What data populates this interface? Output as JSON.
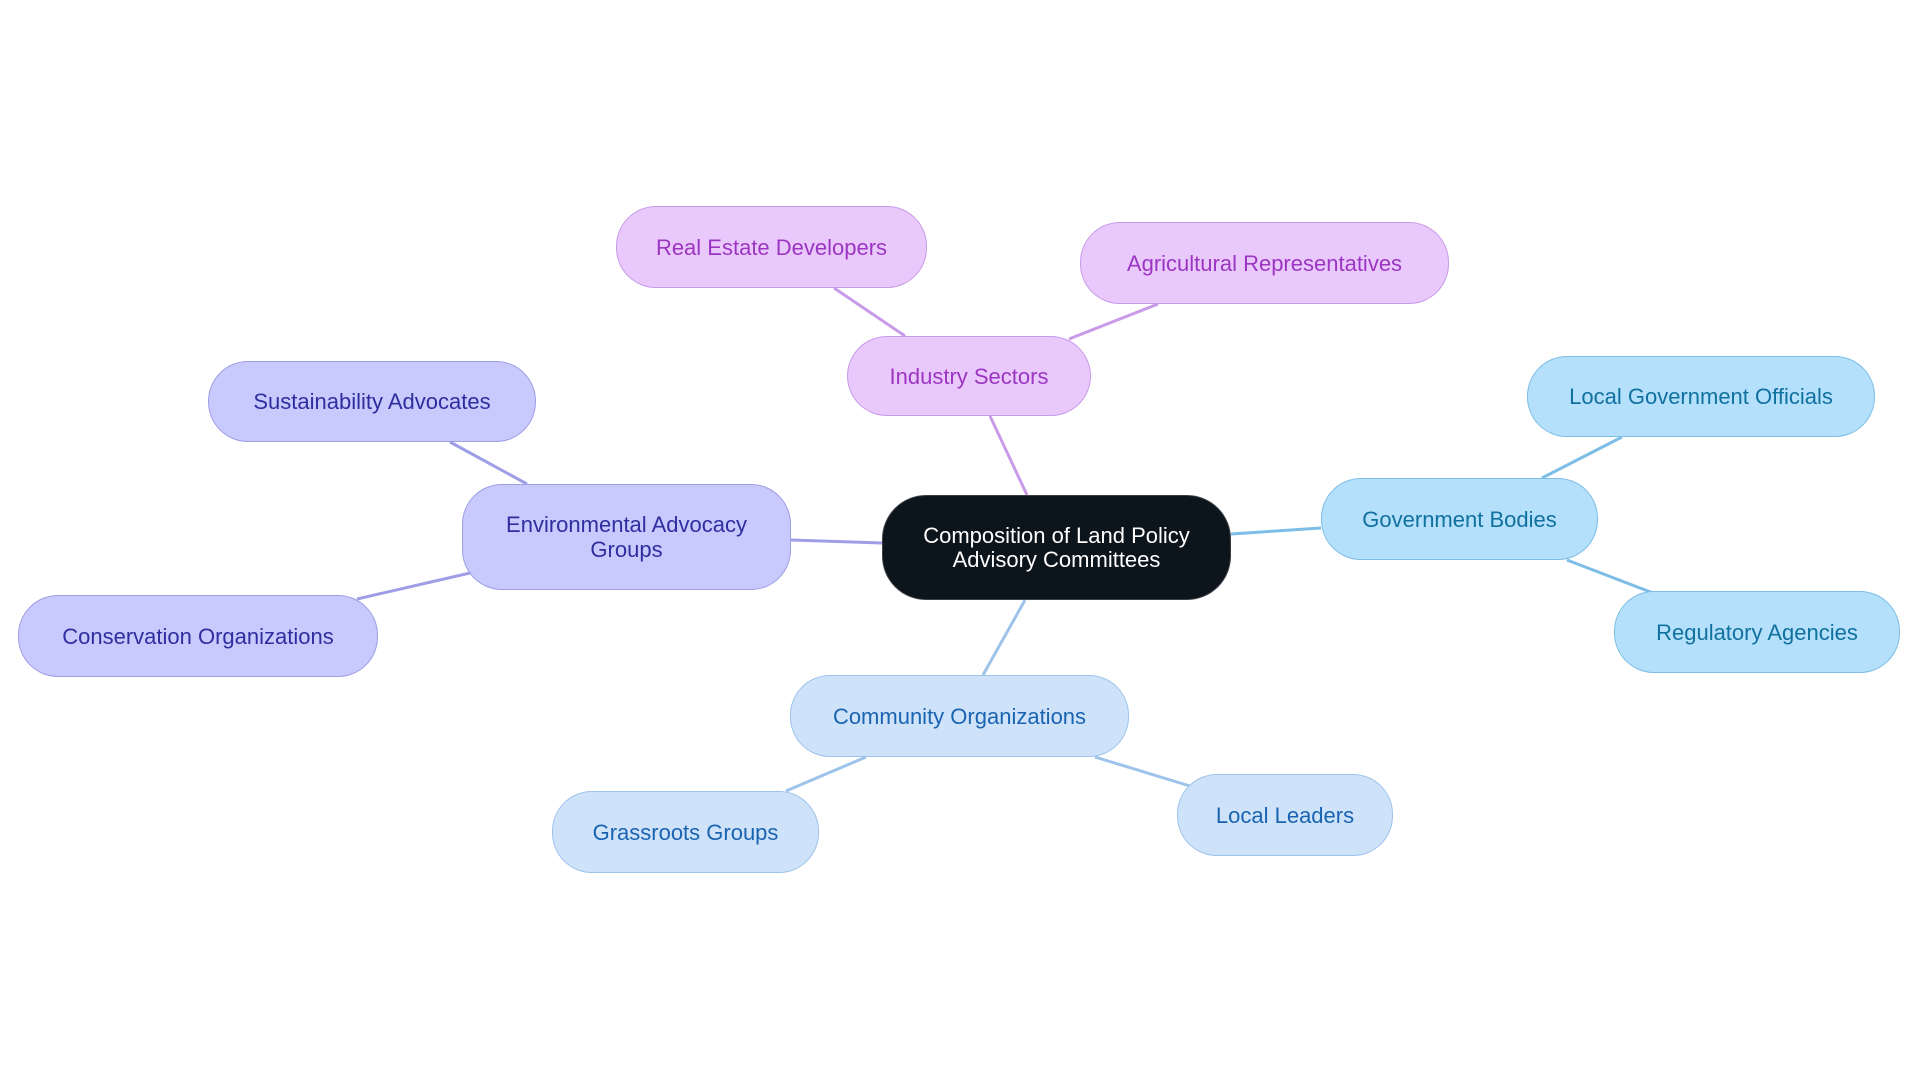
{
  "root": {
    "label": "Composition of Land Policy Advisory Committees"
  },
  "branches": [
    {
      "id": "industry",
      "label": "Industry Sectors",
      "color": "#c99ae8",
      "children": [
        {
          "label": "Real Estate Developers"
        },
        {
          "label": "Agricultural Representatives"
        }
      ]
    },
    {
      "id": "environmental",
      "label": "Environmental Advocacy Groups",
      "color": "#9d9ee6",
      "children": [
        {
          "label": "Sustainability Advocates"
        },
        {
          "label": "Conservation Organizations"
        }
      ]
    },
    {
      "id": "government",
      "label": "Government Bodies",
      "color": "#7dbde6",
      "children": [
        {
          "label": "Local Government Officials"
        },
        {
          "label": "Regulatory Agencies"
        }
      ]
    },
    {
      "id": "community",
      "label": "Community Organizations",
      "color": "#9dc3ea",
      "children": [
        {
          "label": "Grassroots Groups"
        },
        {
          "label": "Local Leaders"
        }
      ]
    }
  ]
}
